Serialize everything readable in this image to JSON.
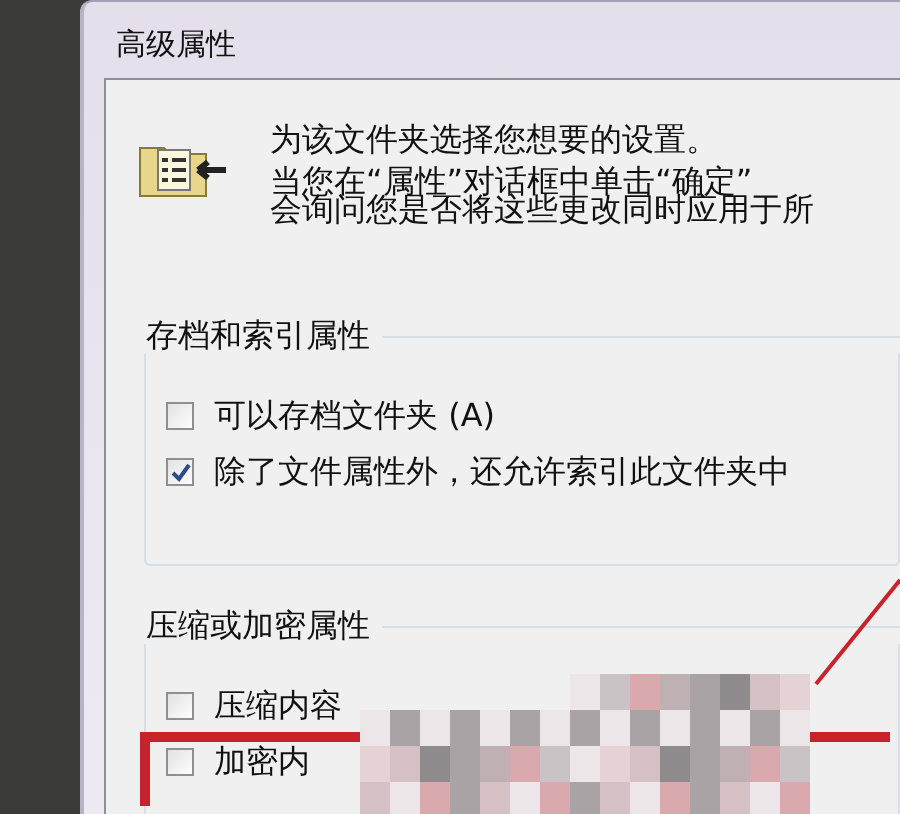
{
  "window": {
    "title": "高级属性"
  },
  "intro": {
    "lines": [
      "为该文件夹选择您想要的设置。",
      "当您在“属性”对话框中单击“确定”",
      "会询问您是否将这些更改同时应用于所"
    ]
  },
  "groups": [
    {
      "title": "存档和索引属性",
      "options": [
        {
          "label": "可以存档文件夹 (A)",
          "checked": false,
          "annotated": false
        },
        {
          "label": "除了文件属性外，还允许索引此文件夹中",
          "checked": true,
          "annotated": false
        }
      ]
    },
    {
      "title": "压缩或加密属性",
      "options": [
        {
          "label": "压缩内容",
          "checked": false,
          "annotated": false
        },
        {
          "label": "加密内",
          "checked": false,
          "annotated": true
        }
      ]
    }
  ]
}
